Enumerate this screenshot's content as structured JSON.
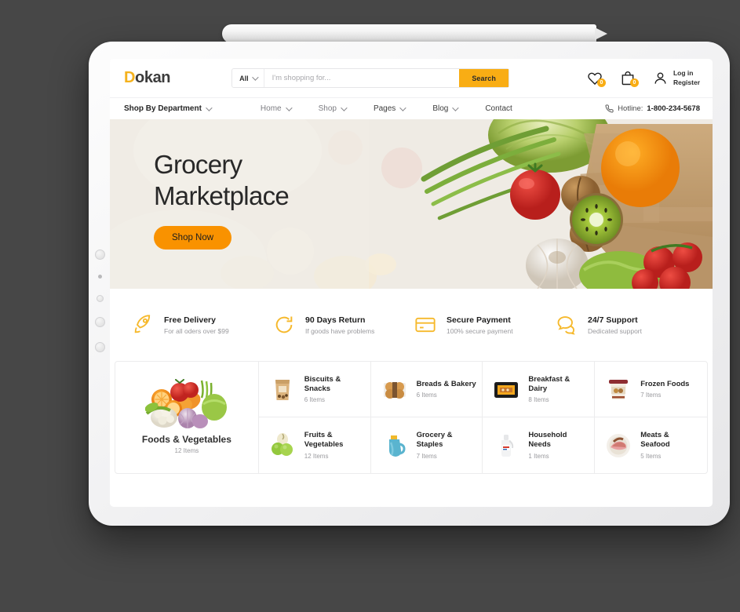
{
  "header": {
    "logo_d": "D",
    "logo_rest": "okan",
    "search": {
      "category": "All",
      "placeholder": "I'm shopping for...",
      "value": "",
      "button": "Search"
    },
    "wishlist_count": "0",
    "cart_count": "0",
    "account_line1": "Log in",
    "account_line2": "Register"
  },
  "nav": {
    "items": [
      {
        "label": "Shop By Department",
        "caret": true,
        "style": "bold"
      },
      {
        "label": "Home",
        "caret": true,
        "style": "muted"
      },
      {
        "label": "Shop",
        "caret": true,
        "style": "muted"
      },
      {
        "label": "Pages",
        "caret": true,
        "style": "dark"
      },
      {
        "label": "Blog",
        "caret": true,
        "style": "dark"
      },
      {
        "label": "Contact",
        "caret": false,
        "style": "dark"
      }
    ],
    "hotline_label": "Hotline:",
    "hotline_number": "1-800-234-5678"
  },
  "hero": {
    "title": "Grocery\nMarketplace",
    "cta": "Shop Now"
  },
  "features": [
    {
      "icon": "rocket-icon",
      "title": "Free Delivery",
      "subtitle": "For all oders over $99"
    },
    {
      "icon": "refresh-icon",
      "title": "90 Days Return",
      "subtitle": "If goods have problems"
    },
    {
      "icon": "credit-card-icon",
      "title": "Secure Payment",
      "subtitle": "100% secure payment"
    },
    {
      "icon": "chat-bubbles-icon",
      "title": "24/7 Support",
      "subtitle": "Dedicated support"
    }
  ],
  "categories": {
    "featured": {
      "title": "Foods & Vegetables",
      "count": "12 Items"
    },
    "cells": [
      {
        "title": "Biscuits &\nSnacks",
        "count": "6 Items"
      },
      {
        "title": "Breads & Bakery",
        "count": "6 Items"
      },
      {
        "title": "Breakfast &\nDairy",
        "count": "8 Items"
      },
      {
        "title": "Frozen Foods",
        "count": "7 Items"
      },
      {
        "title": "Fruits &\nVegetables",
        "count": "12 Items"
      },
      {
        "title": "Grocery &\nStaples",
        "count": "7 Items"
      },
      {
        "title": "Household\nNeeds",
        "count": "1 Items"
      },
      {
        "title": "Meats &\nSeafood",
        "count": "5 Items"
      }
    ]
  },
  "colors": {
    "accent": "#f9ad14",
    "cta": "#f99200",
    "background": "#474747",
    "text_dark": "#262626",
    "text_muted": "#9a9a9e"
  }
}
